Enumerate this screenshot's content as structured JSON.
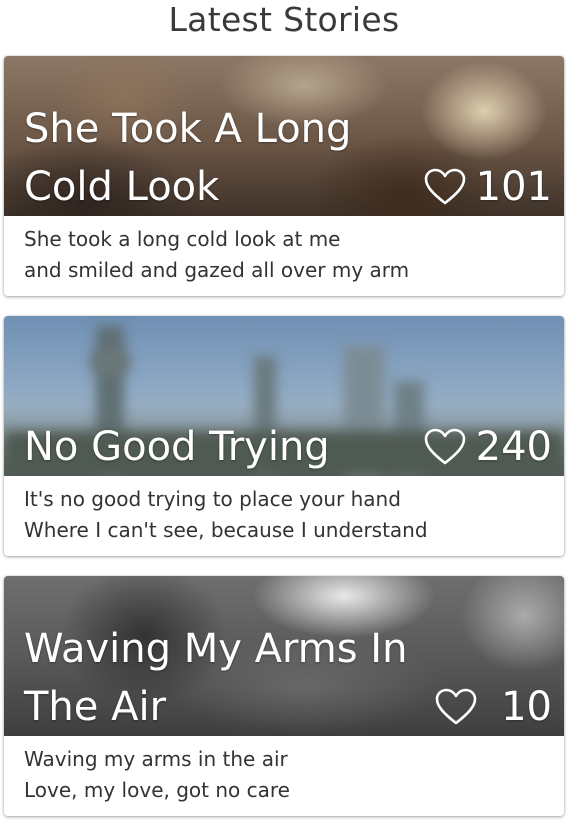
{
  "header": {
    "title": "Latest Stories"
  },
  "stories": [
    {
      "title": "She Took A Long Cold Look",
      "likes": "101",
      "excerpt": [
        "She took a long cold look at me",
        "and smiled and gazed all over my arm"
      ]
    },
    {
      "title": "No Good Trying",
      "likes": "240",
      "excerpt": [
        "It's no good trying to place your hand",
        "Where I can't see, because I understand"
      ]
    },
    {
      "title": "Waving My Arms In The Air",
      "likes": "10",
      "excerpt": [
        "Waving my arms in the air",
        "Love, my love, got no care"
      ]
    }
  ],
  "icons": {
    "like": "heart-outline-icon"
  },
  "colors": {
    "title_text": "#3a3a3a",
    "body_text": "#333333",
    "overlay_text": "#ffffff"
  }
}
